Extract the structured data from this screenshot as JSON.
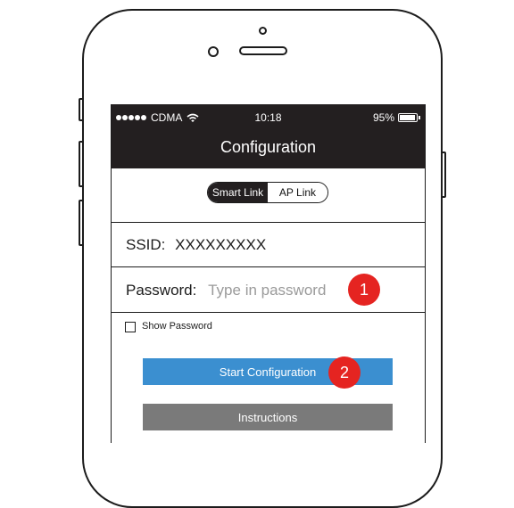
{
  "status_bar": {
    "carrier": "CDMA",
    "time": "10:18",
    "battery": "95%",
    "icons": [
      "signal-dots-icon",
      "wifi-icon",
      "battery-icon"
    ]
  },
  "header": {
    "title": "Configuration"
  },
  "mode_toggle": {
    "options": [
      "Smart Link",
      "AP Link"
    ],
    "selected": "Smart Link"
  },
  "ssid": {
    "label": "SSID:",
    "value": "XXXXXXXXX"
  },
  "password": {
    "label": "Password:",
    "placeholder": "Type in password"
  },
  "show_password": {
    "label": "Show Password",
    "checked": false
  },
  "buttons": {
    "start": "Start Configuration",
    "instructions": "Instructions"
  },
  "callouts": [
    "1",
    "2"
  ],
  "colors": {
    "header_bg": "#231f20",
    "start_button": "#3b8fd0",
    "instructions_button": "#7a7a7a",
    "callout_badge": "#e52421"
  }
}
